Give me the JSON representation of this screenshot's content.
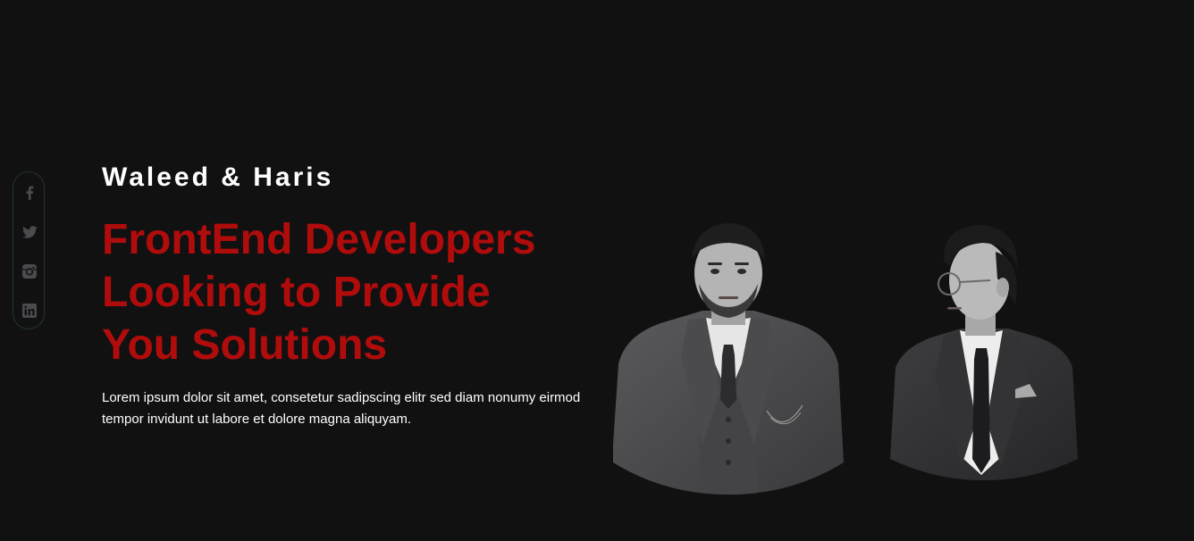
{
  "social": {
    "items": [
      {
        "name": "facebook-icon"
      },
      {
        "name": "twitter-icon"
      },
      {
        "name": "instagram-icon"
      },
      {
        "name": "linkedin-icon"
      }
    ],
    "icon_color": "#4a4a4f",
    "rail_border_color": "#20362a"
  },
  "hero": {
    "names": "Waleed & Haris",
    "title_lines": [
      "FrontEnd Developers",
      "Looking to Provide",
      "You Solutions"
    ],
    "description": "Lorem ipsum dolor sit amet, consetetur sadipscing elitr sed diam nonumy eirmod tempor invidunt ut labore et dolore magna aliquyam.",
    "accent_color": "#b10c0c"
  },
  "portraits": [
    {
      "subject": "person-1-portrait"
    },
    {
      "subject": "person-2-portrait"
    }
  ],
  "colors": {
    "background": "#111112",
    "text": "#ffffff"
  }
}
